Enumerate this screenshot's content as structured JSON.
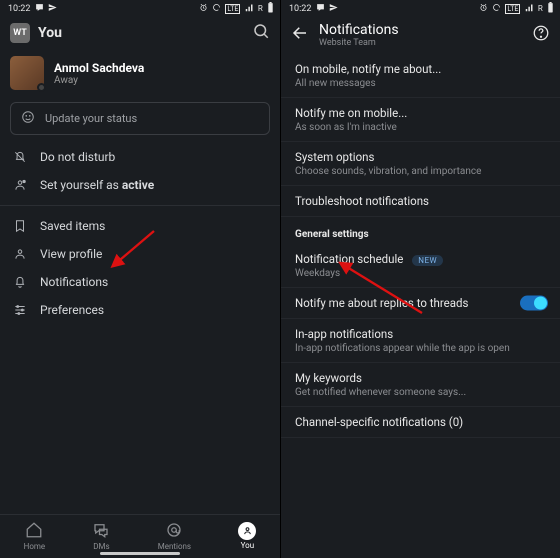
{
  "status": {
    "time": "10:22"
  },
  "left": {
    "workspace_abbr": "WT",
    "title": "You",
    "user_name": "Anmol Sachdeva",
    "presence": "Away",
    "status_placeholder": "Update your status",
    "menu1": [
      {
        "label": "Do not disturb"
      },
      {
        "label_prefix": "Set yourself as ",
        "label_bold": "active"
      }
    ],
    "menu2": [
      {
        "label": "Saved items"
      },
      {
        "label": "View profile"
      },
      {
        "label": "Notifications"
      },
      {
        "label": "Preferences"
      }
    ],
    "nav": {
      "home": "Home",
      "dms": "DMs",
      "mentions": "Mentions",
      "you": "You"
    }
  },
  "right": {
    "title": "Notifications",
    "subtitle": "Website Team",
    "items": {
      "on_mobile_t": "On mobile, notify me about...",
      "on_mobile_s": "All new messages",
      "notify_mobile_t": "Notify me on mobile...",
      "notify_mobile_s": "As soon as I'm inactive",
      "system_t": "System options",
      "system_s": "Choose sounds, vibration, and importance",
      "troubleshoot": "Troubleshoot notifications",
      "section": "General settings",
      "schedule_t": "Notification schedule",
      "schedule_s": "Weekdays",
      "new": "NEW",
      "threads": "Notify me about replies to threads",
      "inapp_t": "In-app notifications",
      "inapp_s": "In-app notifications appear while the app is open",
      "keywords_t": "My keywords",
      "keywords_s": "Get notified whenever someone says...",
      "channel": "Channel-specific notifications (0)"
    }
  }
}
